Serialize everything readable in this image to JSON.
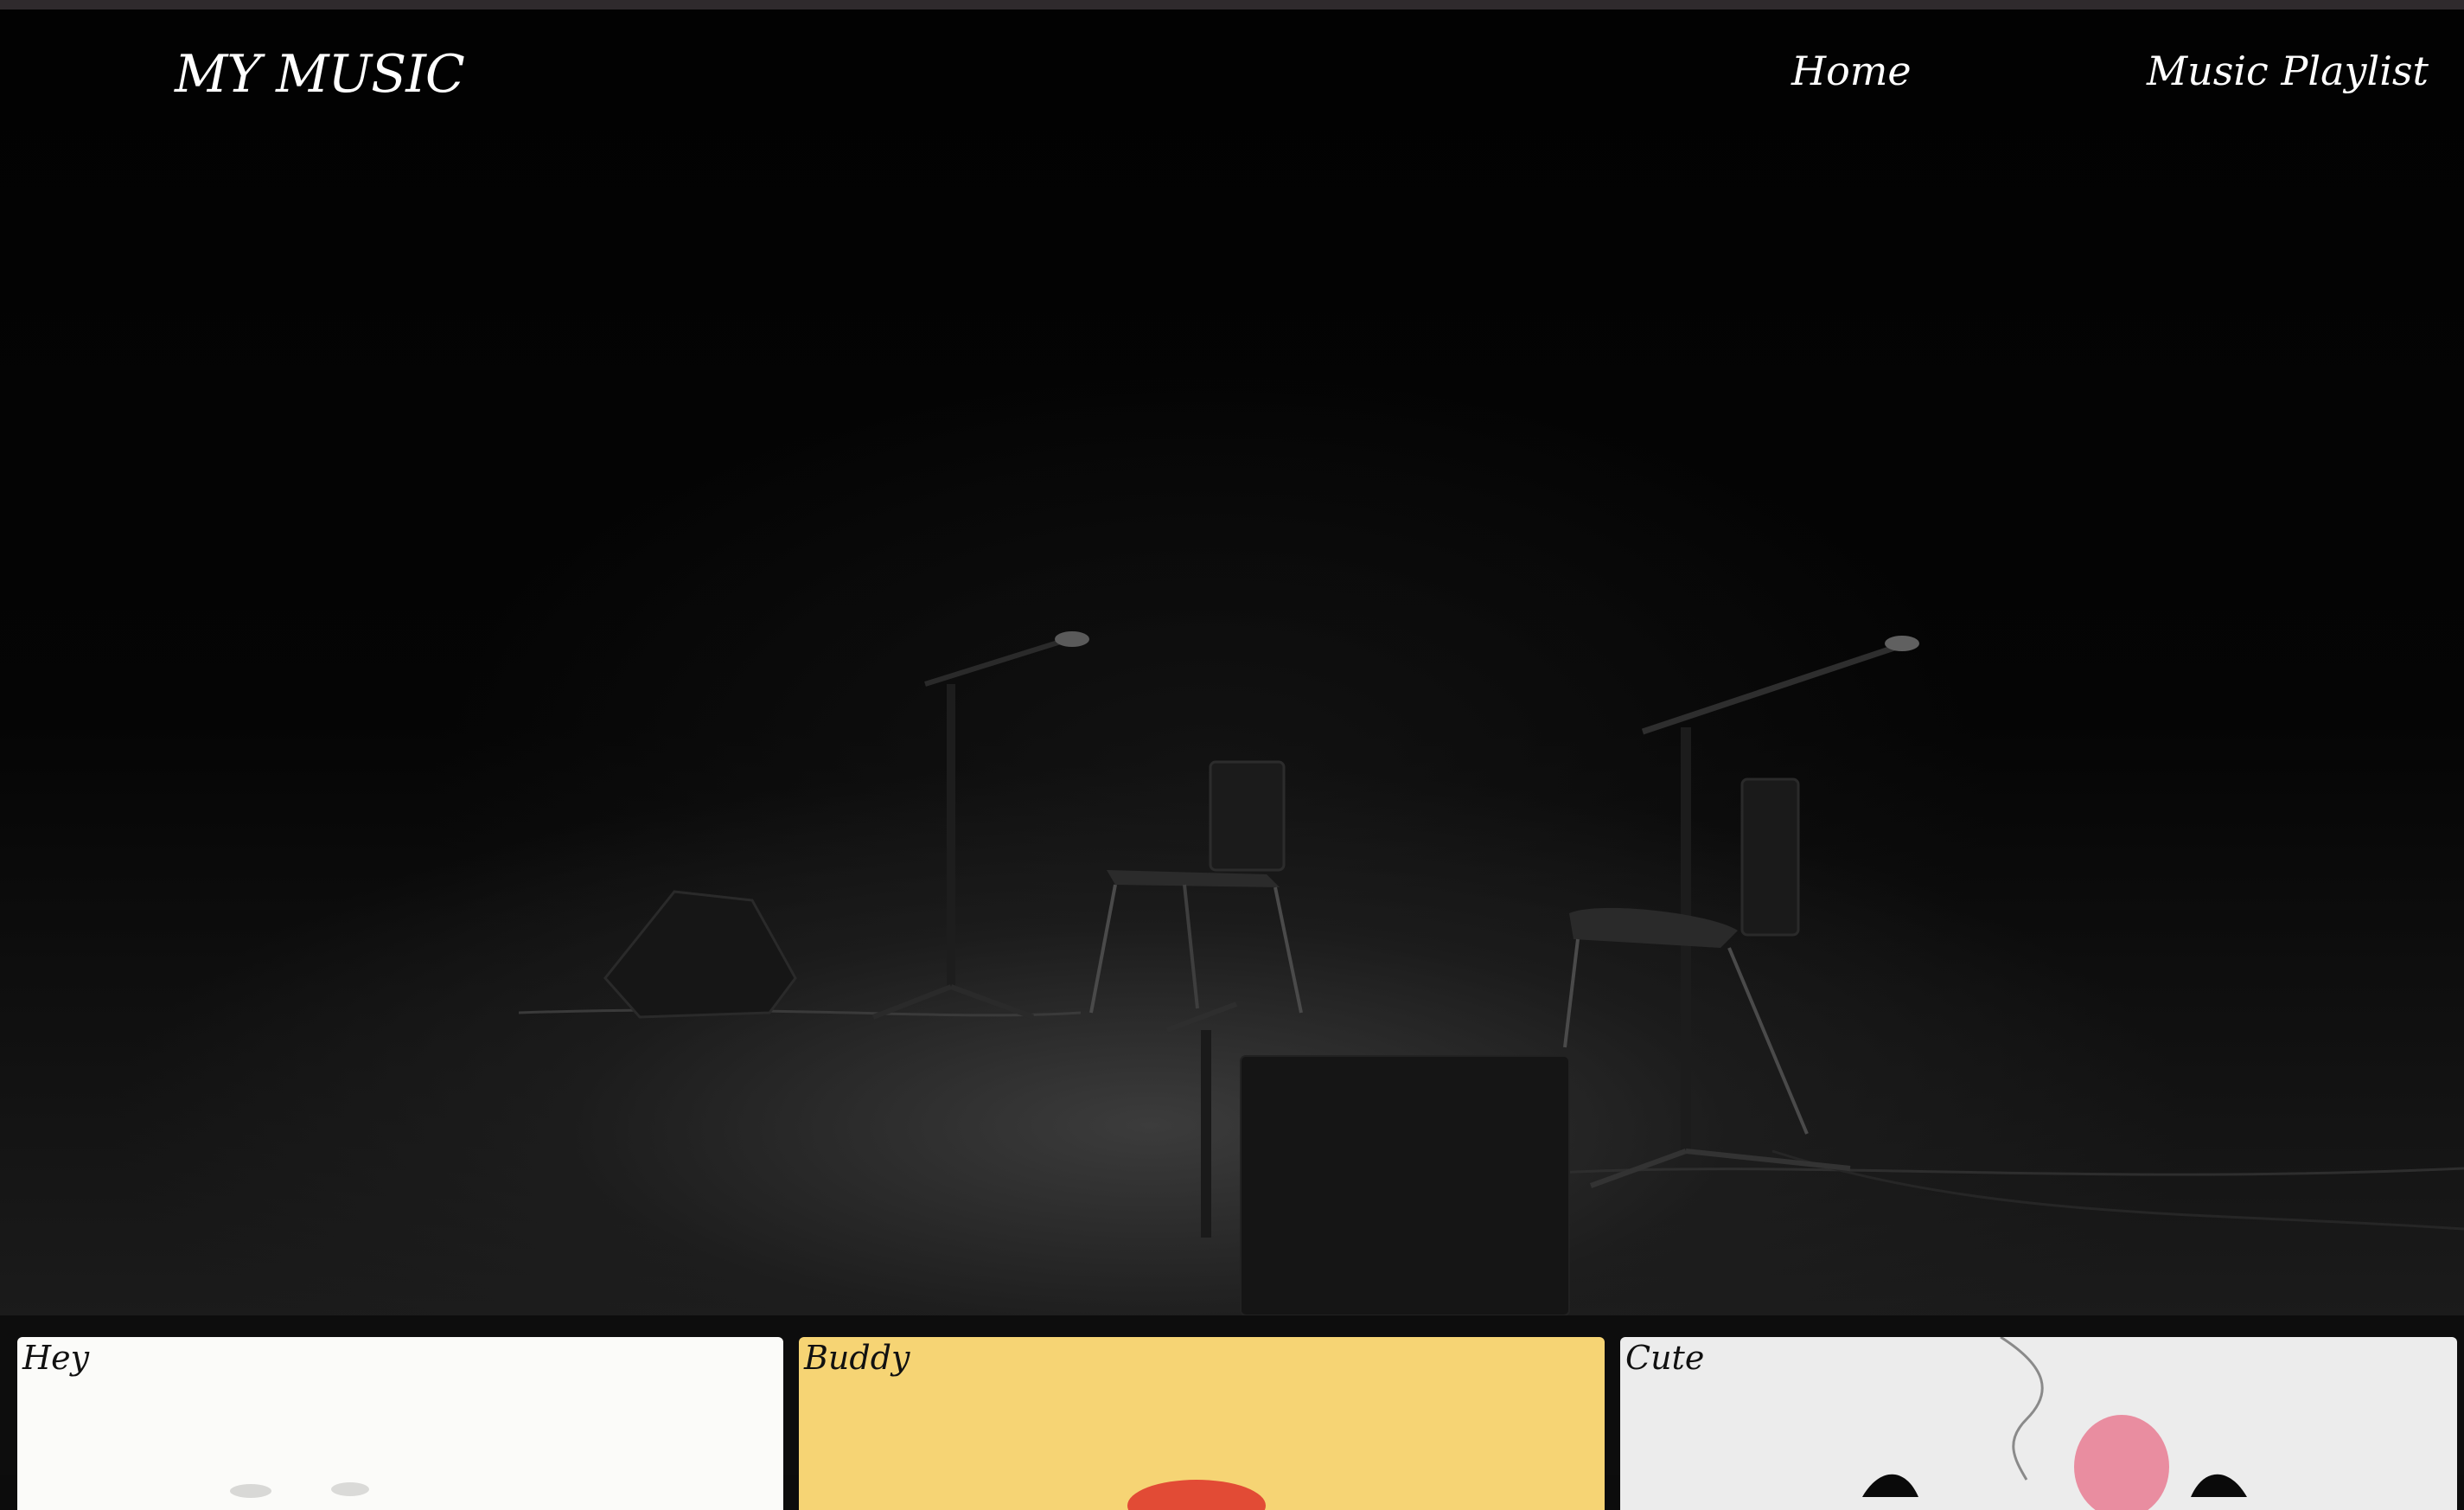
{
  "header": {
    "brand": "MY MUSIC",
    "nav": [
      {
        "label": "Home"
      },
      {
        "label": "Music Playlist"
      }
    ]
  },
  "hero": {
    "image": "stage-with-microphones-and-chairs"
  },
  "cards": [
    {
      "title": "Hey",
      "color": "#fbfbf9"
    },
    {
      "title": "Buddy",
      "color": "#f6d474"
    },
    {
      "title": "Cute",
      "color": "#ececec"
    }
  ],
  "colors": {
    "background": "#0c0c0c",
    "text": "#ffffff",
    "top_strip": "#2f2a2d"
  }
}
